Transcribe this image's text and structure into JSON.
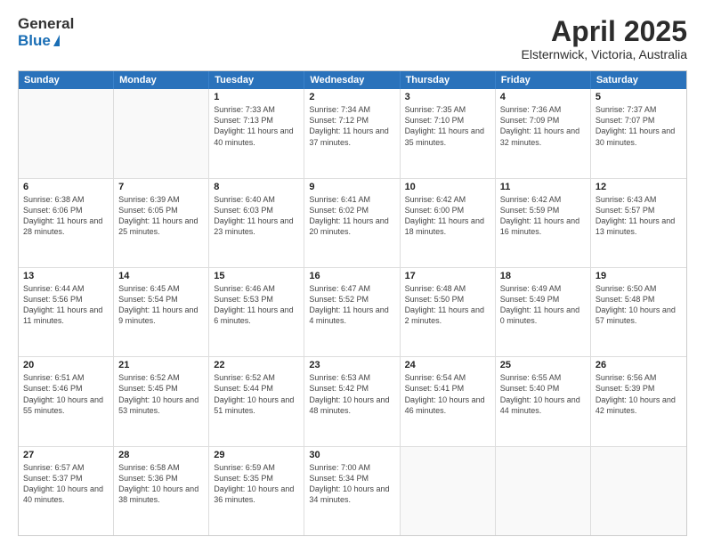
{
  "header": {
    "logo_line1": "General",
    "logo_line2": "Blue",
    "title": "April 2025",
    "location": "Elsternwick, Victoria, Australia"
  },
  "calendar": {
    "days_of_week": [
      "Sunday",
      "Monday",
      "Tuesday",
      "Wednesday",
      "Thursday",
      "Friday",
      "Saturday"
    ],
    "weeks": [
      [
        {
          "day": "",
          "empty": true
        },
        {
          "day": "",
          "empty": true
        },
        {
          "day": "1",
          "sunrise": "Sunrise: 7:33 AM",
          "sunset": "Sunset: 7:13 PM",
          "daylight": "Daylight: 11 hours and 40 minutes."
        },
        {
          "day": "2",
          "sunrise": "Sunrise: 7:34 AM",
          "sunset": "Sunset: 7:12 PM",
          "daylight": "Daylight: 11 hours and 37 minutes."
        },
        {
          "day": "3",
          "sunrise": "Sunrise: 7:35 AM",
          "sunset": "Sunset: 7:10 PM",
          "daylight": "Daylight: 11 hours and 35 minutes."
        },
        {
          "day": "4",
          "sunrise": "Sunrise: 7:36 AM",
          "sunset": "Sunset: 7:09 PM",
          "daylight": "Daylight: 11 hours and 32 minutes."
        },
        {
          "day": "5",
          "sunrise": "Sunrise: 7:37 AM",
          "sunset": "Sunset: 7:07 PM",
          "daylight": "Daylight: 11 hours and 30 minutes."
        }
      ],
      [
        {
          "day": "6",
          "sunrise": "Sunrise: 6:38 AM",
          "sunset": "Sunset: 6:06 PM",
          "daylight": "Daylight: 11 hours and 28 minutes."
        },
        {
          "day": "7",
          "sunrise": "Sunrise: 6:39 AM",
          "sunset": "Sunset: 6:05 PM",
          "daylight": "Daylight: 11 hours and 25 minutes."
        },
        {
          "day": "8",
          "sunrise": "Sunrise: 6:40 AM",
          "sunset": "Sunset: 6:03 PM",
          "daylight": "Daylight: 11 hours and 23 minutes."
        },
        {
          "day": "9",
          "sunrise": "Sunrise: 6:41 AM",
          "sunset": "Sunset: 6:02 PM",
          "daylight": "Daylight: 11 hours and 20 minutes."
        },
        {
          "day": "10",
          "sunrise": "Sunrise: 6:42 AM",
          "sunset": "Sunset: 6:00 PM",
          "daylight": "Daylight: 11 hours and 18 minutes."
        },
        {
          "day": "11",
          "sunrise": "Sunrise: 6:42 AM",
          "sunset": "Sunset: 5:59 PM",
          "daylight": "Daylight: 11 hours and 16 minutes."
        },
        {
          "day": "12",
          "sunrise": "Sunrise: 6:43 AM",
          "sunset": "Sunset: 5:57 PM",
          "daylight": "Daylight: 11 hours and 13 minutes."
        }
      ],
      [
        {
          "day": "13",
          "sunrise": "Sunrise: 6:44 AM",
          "sunset": "Sunset: 5:56 PM",
          "daylight": "Daylight: 11 hours and 11 minutes."
        },
        {
          "day": "14",
          "sunrise": "Sunrise: 6:45 AM",
          "sunset": "Sunset: 5:54 PM",
          "daylight": "Daylight: 11 hours and 9 minutes."
        },
        {
          "day": "15",
          "sunrise": "Sunrise: 6:46 AM",
          "sunset": "Sunset: 5:53 PM",
          "daylight": "Daylight: 11 hours and 6 minutes."
        },
        {
          "day": "16",
          "sunrise": "Sunrise: 6:47 AM",
          "sunset": "Sunset: 5:52 PM",
          "daylight": "Daylight: 11 hours and 4 minutes."
        },
        {
          "day": "17",
          "sunrise": "Sunrise: 6:48 AM",
          "sunset": "Sunset: 5:50 PM",
          "daylight": "Daylight: 11 hours and 2 minutes."
        },
        {
          "day": "18",
          "sunrise": "Sunrise: 6:49 AM",
          "sunset": "Sunset: 5:49 PM",
          "daylight": "Daylight: 11 hours and 0 minutes."
        },
        {
          "day": "19",
          "sunrise": "Sunrise: 6:50 AM",
          "sunset": "Sunset: 5:48 PM",
          "daylight": "Daylight: 10 hours and 57 minutes."
        }
      ],
      [
        {
          "day": "20",
          "sunrise": "Sunrise: 6:51 AM",
          "sunset": "Sunset: 5:46 PM",
          "daylight": "Daylight: 10 hours and 55 minutes."
        },
        {
          "day": "21",
          "sunrise": "Sunrise: 6:52 AM",
          "sunset": "Sunset: 5:45 PM",
          "daylight": "Daylight: 10 hours and 53 minutes."
        },
        {
          "day": "22",
          "sunrise": "Sunrise: 6:52 AM",
          "sunset": "Sunset: 5:44 PM",
          "daylight": "Daylight: 10 hours and 51 minutes."
        },
        {
          "day": "23",
          "sunrise": "Sunrise: 6:53 AM",
          "sunset": "Sunset: 5:42 PM",
          "daylight": "Daylight: 10 hours and 48 minutes."
        },
        {
          "day": "24",
          "sunrise": "Sunrise: 6:54 AM",
          "sunset": "Sunset: 5:41 PM",
          "daylight": "Daylight: 10 hours and 46 minutes."
        },
        {
          "day": "25",
          "sunrise": "Sunrise: 6:55 AM",
          "sunset": "Sunset: 5:40 PM",
          "daylight": "Daylight: 10 hours and 44 minutes."
        },
        {
          "day": "26",
          "sunrise": "Sunrise: 6:56 AM",
          "sunset": "Sunset: 5:39 PM",
          "daylight": "Daylight: 10 hours and 42 minutes."
        }
      ],
      [
        {
          "day": "27",
          "sunrise": "Sunrise: 6:57 AM",
          "sunset": "Sunset: 5:37 PM",
          "daylight": "Daylight: 10 hours and 40 minutes."
        },
        {
          "day": "28",
          "sunrise": "Sunrise: 6:58 AM",
          "sunset": "Sunset: 5:36 PM",
          "daylight": "Daylight: 10 hours and 38 minutes."
        },
        {
          "day": "29",
          "sunrise": "Sunrise: 6:59 AM",
          "sunset": "Sunset: 5:35 PM",
          "daylight": "Daylight: 10 hours and 36 minutes."
        },
        {
          "day": "30",
          "sunrise": "Sunrise: 7:00 AM",
          "sunset": "Sunset: 5:34 PM",
          "daylight": "Daylight: 10 hours and 34 minutes."
        },
        {
          "day": "",
          "empty": true
        },
        {
          "day": "",
          "empty": true
        },
        {
          "day": "",
          "empty": true
        }
      ]
    ]
  }
}
